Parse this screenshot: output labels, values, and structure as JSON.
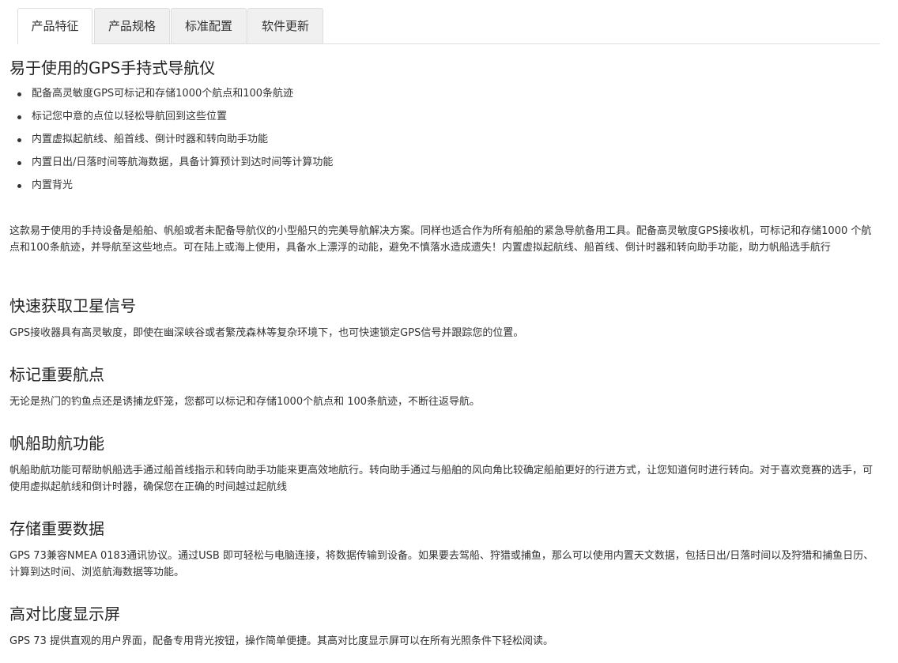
{
  "tabs": [
    "产品特征",
    "产品规格",
    "标准配置",
    "软件更新"
  ],
  "intro": {
    "title": "易于使用的GPS手持式导航仪",
    "bullets": [
      "配备高灵敏度GPS可标记和存储1000个航点和100条航迹",
      "标记您中意的点位以轻松导航回到这些位置",
      "内置虚拟起航线、船首线、倒计时器和转向助手功能",
      "内置日出/日落时间等航海数据，具备计算预计到达时间等计算功能",
      "内置背光"
    ],
    "paragraph": "这款易于使用的手持设备是船舶、帆船或者未配备导航仪的小型船只的完美导航解决方案。同样也适合作为所有船舶的紧急导航备用工具。配备高灵敏度GPS接收机，可标记和存储1000 个航点和100条航迹，并导航至这些地点。可在陆上或海上使用，具备水上漂浮的动能，避免不慎落水造成遗失！内置虚拟起航线、船首线、倒计时器和转向助手功能，助力帆船选手航行"
  },
  "sections": [
    {
      "title": "快速获取卫星信号",
      "text": "GPS接收器具有高灵敏度，即使在幽深峡谷或者繁茂森林等复杂环境下，也可快速锁定GPS信号并跟踪您的位置。"
    },
    {
      "title": "标记重要航点",
      "text": "无论是热门的钓鱼点还是诱捕龙虾笼，您都可以标记和存储1000个航点和 100条航迹，不断往返导航。"
    },
    {
      "title": "帆船助航功能",
      "text": "帆船助航功能可帮助帆船选手通过船首线指示和转向助手功能来更高效地航行。转向助手通过与船舶的风向角比较确定船舶更好的行进方式，让您知道何时进行转向。对于喜欢竞赛的选手，可使用虚拟起航线和倒计时器，确保您在正确的时间越过起航线"
    },
    {
      "title": "存储重要数据",
      "text": "GPS 73兼容NMEA 0183通讯协议。通过USB 即可轻松与电脑连接，将数据传输到设备。如果要去驾船、狩猎或捕鱼，那么可以使用内置天文数据，包括日出/日落时间以及狩猎和捕鱼日历、计算到达时间、浏览航海数据等功能。"
    },
    {
      "title": "高对比度显示屏",
      "text": "GPS 73 提供直观的用户界面，配备专用背光按钮，操作简单便捷。其高对比度显示屏可以在所有光照条件下轻松阅读。"
    }
  ]
}
